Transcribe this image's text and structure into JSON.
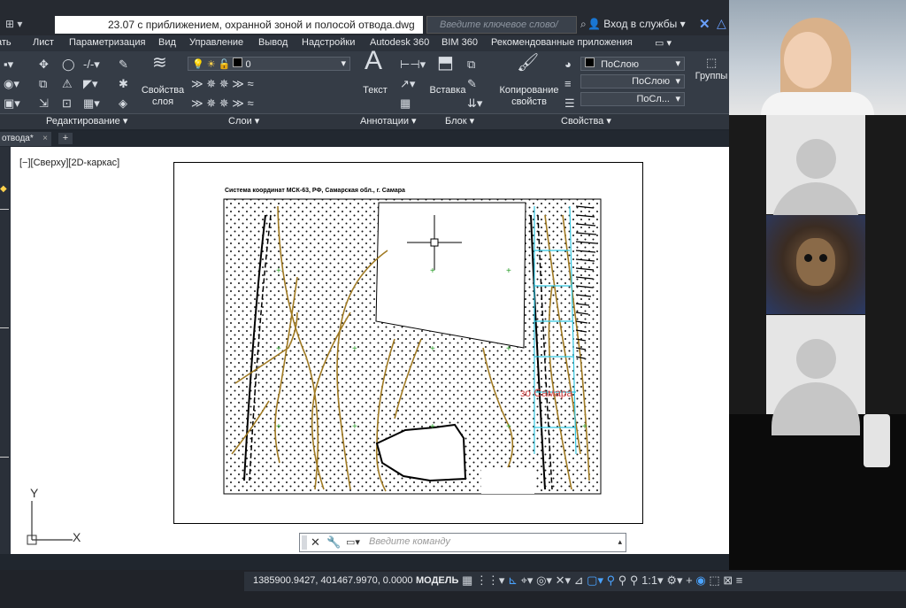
{
  "window": {
    "file_title": "23.07 с приближением, охранной зоной и полосой отвода.dwg",
    "search_placeholder": "Введите ключевое слово/фразу",
    "sign_in": "Вход в службы"
  },
  "menu": [
    "Лист",
    "Параметризация",
    "Вид",
    "Управление",
    "Вывод",
    "Надстройки",
    "Autodesk 360",
    "BIM 360",
    "Рекомендованные приложения"
  ],
  "ribbon": {
    "layer_props": "Свойства\nслоя",
    "layer_current": "0",
    "text_btn": "Текст",
    "insert_btn": "Вставка",
    "copy_props": "Копирование\nсвойств",
    "bylayer_color": "ПоСлою",
    "bylayer_linetype": "ПоСлою",
    "bylayer_lineweight": "ПоСл...",
    "groups": "Группы",
    "panels": [
      "Редактирование ▾",
      "Слои ▾",
      "Аннотации ▾",
      "Блок ▾",
      "Свойства ▾"
    ]
  },
  "tabs": {
    "doc_tab": "отвода*"
  },
  "viewport": {
    "label": "[−][Сверху][2D-каркас]"
  },
  "drawing": {
    "title": "Система координат МСК-63, РФ, Самарская обл., г. Самара",
    "red_label": "зо Самара"
  },
  "ucs": {
    "x": "X",
    "y": "Y"
  },
  "command": {
    "placeholder": "Введите команду"
  },
  "status": {
    "coords": "1385900.9427, 401467.9970, 0.0000",
    "model": "МОДЕЛЬ",
    "scale": "1:1"
  },
  "colors": {
    "accent": "#2b6fd6",
    "contour": "#a07a22",
    "cyan": "#33c6e0",
    "red": "#d04040"
  }
}
